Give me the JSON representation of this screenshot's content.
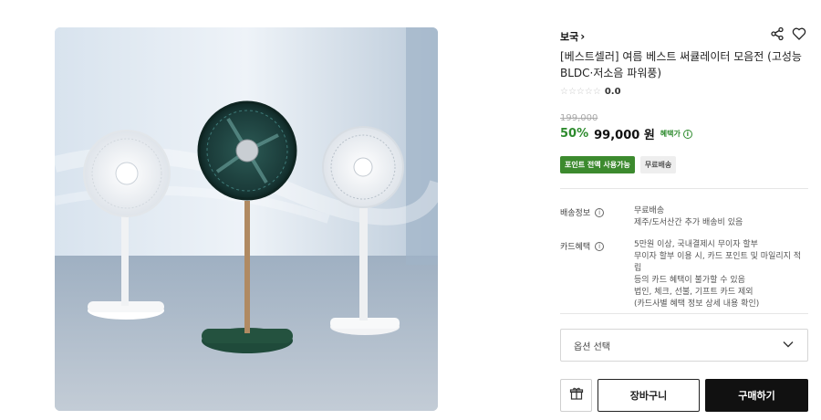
{
  "product": {
    "brand": "보국",
    "title": "[베스트셀러] 여름 베스트 써큘레이터 모음전 (고성능 BLDC·저소음 파워풍)",
    "rating": {
      "stars": "☆☆☆☆☆",
      "value": "0.0"
    },
    "original_price": "199,000",
    "discount": "50%",
    "sale_price": "99,000 원",
    "benefit_label": "혜택가"
  },
  "badges": [
    "포인트 전액 사용가능",
    "무료배송"
  ],
  "shipping": {
    "label": "배송정보",
    "lines": [
      "무료배송",
      "제주/도서산간 추가 배송비 있음"
    ]
  },
  "card": {
    "label": "카드혜택",
    "lines": [
      "5만원 이상, 국내결제시 무이자 할부",
      "무이자 할부 이용 시, 카드 포인트 및 마일리지 적립",
      "등의 카드 혜택이 불가할 수 있음",
      "법인, 체크, 선불, 기프트 카드 제외",
      "(카드사별 혜택 정보 상세 내용 확인)"
    ]
  },
  "option_select": {
    "placeholder": "옵션 선택"
  },
  "actions": {
    "cart": "장바구니",
    "buy": "구매하기"
  },
  "colors": {
    "accent_green": "#2e8b2e",
    "badge_green": "#3c8a2e",
    "buy_button": "#111111"
  },
  "icons": [
    "chevron-right-icon",
    "share-icon",
    "heart-icon",
    "info-icon",
    "chevron-down-icon",
    "gift-icon"
  ]
}
